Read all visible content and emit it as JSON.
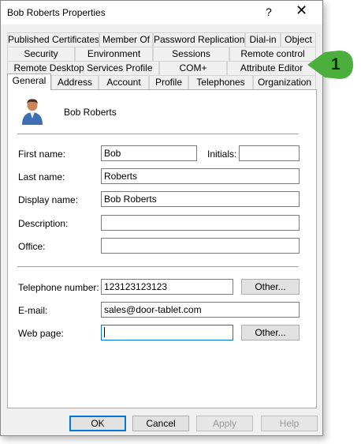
{
  "window": {
    "title": "Bob Roberts Properties",
    "help_label": "?",
    "close_label": "✕"
  },
  "tabs": {
    "row1": [
      "Published Certificates",
      "Member Of",
      "Password Replication",
      "Dial-in",
      "Object"
    ],
    "row2": [
      "Security",
      "Environment",
      "Sessions",
      "Remote control"
    ],
    "row3": [
      "Remote Desktop Services Profile",
      "COM+",
      "Attribute Editor"
    ],
    "row4": [
      "General",
      "Address",
      "Account",
      "Profile",
      "Telephones",
      "Organization"
    ],
    "active": "General"
  },
  "user": {
    "name": "Bob Roberts",
    "icon": "user-avatar-icon"
  },
  "fields": {
    "first_name": {
      "label": "First name:",
      "value": "Bob"
    },
    "initials": {
      "label": "Initials:",
      "value": ""
    },
    "last_name": {
      "label": "Last name:",
      "value": "Roberts"
    },
    "display_name": {
      "label": "Display name:",
      "value": "Bob Roberts"
    },
    "description": {
      "label": "Description:",
      "value": ""
    },
    "office": {
      "label": "Office:",
      "value": ""
    },
    "telephone": {
      "label": "Telephone number:",
      "value": "123123123123"
    },
    "email": {
      "label": "E-mail:",
      "value": "sales@door-tablet.com"
    },
    "web_page": {
      "label": "Web page:",
      "value": ""
    }
  },
  "buttons": {
    "other_phone": "Other...",
    "other_web": "Other...",
    "ok": "OK",
    "cancel": "Cancel",
    "apply": "Apply",
    "help": "Help"
  },
  "annotation": {
    "number": "1",
    "color": "#4caf3d"
  }
}
